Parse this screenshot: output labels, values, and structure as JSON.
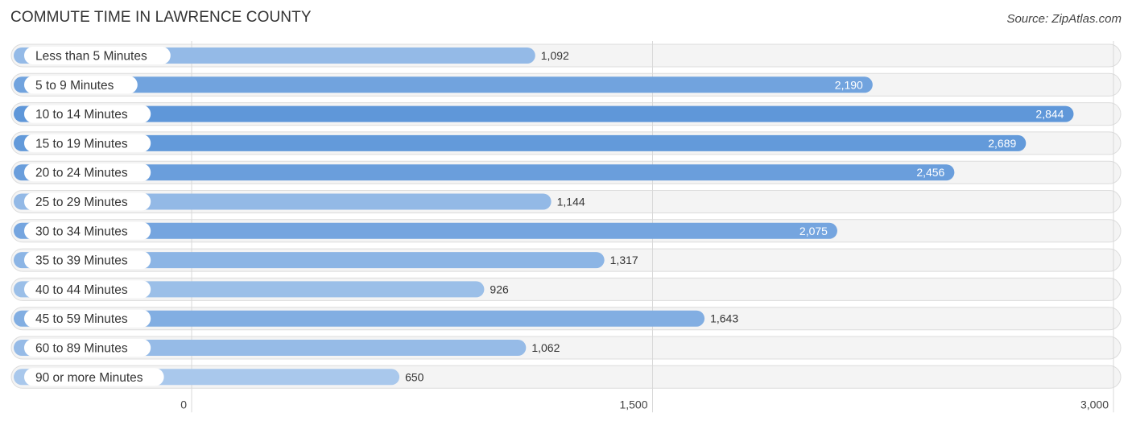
{
  "header": {
    "title": "COMMUTE TIME IN LAWRENCE COUNTY",
    "source": "Source: ZipAtlas.com"
  },
  "colors": {
    "bar_light": "#a9c8ec",
    "bar_dark": "#5f97d9",
    "value_inside": "#ffffff",
    "value_outside": "#333333"
  },
  "chart_data": {
    "type": "bar",
    "orientation": "horizontal",
    "title": "COMMUTE TIME IN LAWRENCE COUNTY",
    "xlabel": "",
    "ylabel": "",
    "categories": [
      "Less than 5 Minutes",
      "5 to 9 Minutes",
      "10 to 14 Minutes",
      "15 to 19 Minutes",
      "20 to 24 Minutes",
      "25 to 29 Minutes",
      "30 to 34 Minutes",
      "35 to 39 Minutes",
      "40 to 44 Minutes",
      "45 to 59 Minutes",
      "60 to 89 Minutes",
      "90 or more Minutes"
    ],
    "values": [
      1092,
      2190,
      2844,
      2689,
      2456,
      1144,
      2075,
      1317,
      926,
      1643,
      1062,
      650
    ],
    "value_labels": [
      "1,092",
      "2,190",
      "2,844",
      "2,689",
      "2,456",
      "1,144",
      "2,075",
      "1,317",
      "926",
      "1,643",
      "1,062",
      "650"
    ],
    "xlim": [
      0,
      3000
    ],
    "xticks": [
      0,
      1500,
      3000
    ],
    "xtick_labels": [
      "0",
      "1,500",
      "3,000"
    ],
    "grid": true,
    "legend": "none"
  }
}
